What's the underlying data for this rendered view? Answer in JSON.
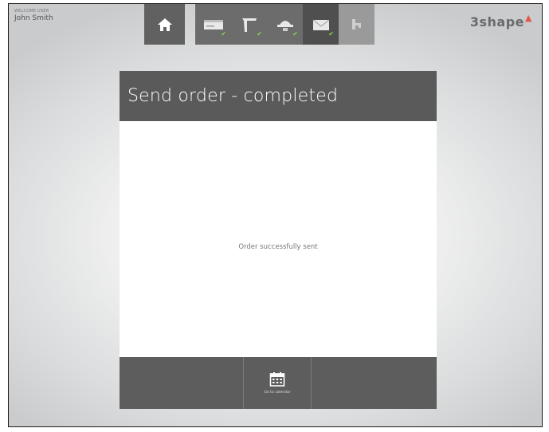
{
  "user": {
    "caption": "WELCOME USER",
    "name": "John Smith"
  },
  "nav": {
    "steps": [
      {
        "icon": "home-icon"
      },
      {
        "icon": "order-form-icon",
        "done": true
      },
      {
        "icon": "scan-icon",
        "done": true
      },
      {
        "icon": "design-icon",
        "done": true
      },
      {
        "icon": "send-icon",
        "done": true,
        "active": true
      },
      {
        "icon": "return-icon",
        "disabled": true
      }
    ],
    "check_mark": "✔"
  },
  "logo": {
    "text": "3shape",
    "mark": "▲"
  },
  "dialog": {
    "title": "Send order - completed",
    "message": "Order successfully sent",
    "footer_button_label": "Go to calendar"
  },
  "colors": {
    "header": "#5a5a5a",
    "footer": "#5d5d5d",
    "check": "#8bd14d",
    "logo_accent": "#e2574c"
  }
}
